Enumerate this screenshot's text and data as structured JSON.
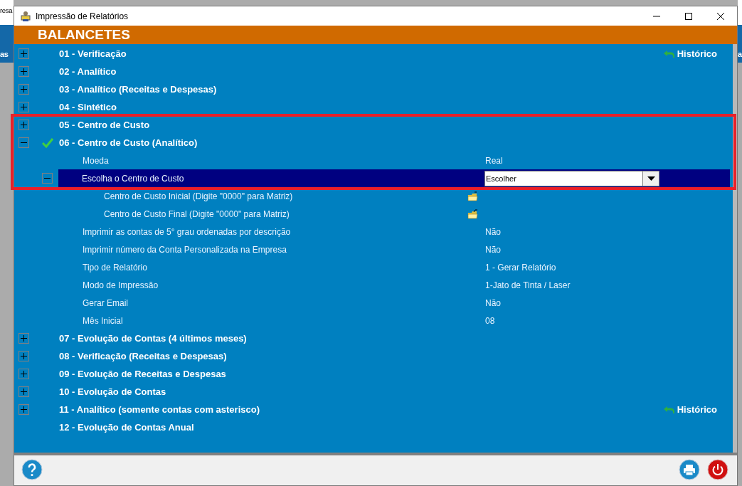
{
  "background": {
    "texts": [
      "resa",
      "as",
      "a"
    ]
  },
  "window": {
    "title": "Impressão de Relatórios"
  },
  "section": {
    "title": "BALANCETES"
  },
  "reports": [
    {
      "kind": "group",
      "label": "01 - Verificação",
      "expanded": false,
      "checked": false,
      "history": "Histórico"
    },
    {
      "kind": "group",
      "label": "02 - Analítico",
      "expanded": false,
      "checked": false
    },
    {
      "kind": "group",
      "label": "03 - Analítico (Receitas e Despesas)",
      "expanded": false,
      "checked": false
    },
    {
      "kind": "group",
      "label": "04 - Sintético",
      "expanded": false,
      "checked": false
    },
    {
      "kind": "group",
      "label": "05 - Centro de Custo",
      "expanded": false,
      "checked": false
    },
    {
      "kind": "group",
      "label": "06 - Centro de Custo (Analítico)",
      "expanded": true,
      "checked": true,
      "options": [
        {
          "kind": "value",
          "label": "Moeda",
          "value": "Real"
        },
        {
          "kind": "dropdown",
          "label": "Escolha o Centro de Custo",
          "value": "Escolher",
          "expanded": true,
          "selected": true,
          "children": [
            {
              "kind": "open-folder",
              "label": "Centro de Custo Inicial (Digite \"0000\" para Matriz)"
            },
            {
              "kind": "folder-return",
              "label": "Centro de Custo Final (Digite \"0000\" para Matriz)"
            }
          ]
        },
        {
          "kind": "value",
          "label": "Imprimir as contas de 5° grau ordenadas por descrição",
          "value": "Não"
        },
        {
          "kind": "value",
          "label": "Imprimir número da Conta Personalizada na Empresa",
          "value": "Não"
        },
        {
          "kind": "value",
          "label": "Tipo de Relatório",
          "value": "1 - Gerar Relatório"
        },
        {
          "kind": "value",
          "label": "Modo de Impressão",
          "value": "1-Jato de Tinta / Laser"
        },
        {
          "kind": "value",
          "label": "Gerar Email",
          "value": "Não"
        },
        {
          "kind": "value",
          "label": "Mês Inicial",
          "value": "08"
        }
      ]
    },
    {
      "kind": "group",
      "label": "07 - Evolução de Contas (4 últimos meses)",
      "expanded": false,
      "checked": false
    },
    {
      "kind": "group",
      "label": "08 - Verificação (Receitas e Despesas)",
      "expanded": false,
      "checked": false
    },
    {
      "kind": "group",
      "label": "09 - Evolução de Receitas e Despesas",
      "expanded": false,
      "checked": false
    },
    {
      "kind": "group",
      "label": "10 - Evolução de Contas",
      "expanded": false,
      "checked": false
    },
    {
      "kind": "group",
      "label": "11 - Analítico (somente contas com asterisco)",
      "expanded": false,
      "checked": false,
      "history": "Histórico"
    },
    {
      "kind": "plain",
      "label": "12 - Evolução de Contas Anual",
      "checked": false
    }
  ]
}
